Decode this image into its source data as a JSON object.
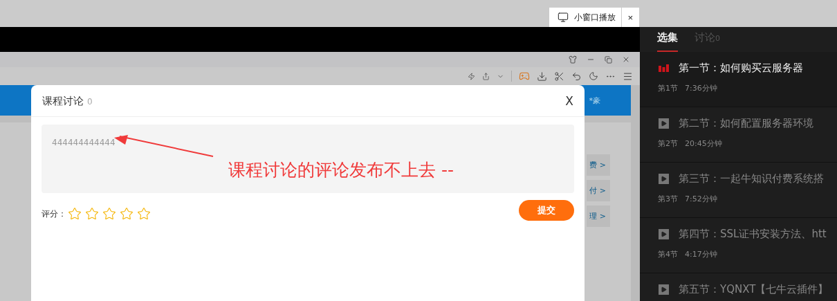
{
  "top_bar": {
    "pip_button": "小窗口播放",
    "close_button": "×"
  },
  "browser": {
    "header_text": "*豪",
    "side_links": [
      "费 >",
      "付 >",
      "理 >"
    ]
  },
  "dialog": {
    "title": "课程讨论",
    "count": "0",
    "close": "X",
    "comment": "444444444444",
    "rating_label": "评分：",
    "stars": 0,
    "submit": "提交"
  },
  "annotation": {
    "text": "课程讨论的评论发布不上去 --"
  },
  "sidebar": {
    "tabs": [
      {
        "label": "选集",
        "selected": true
      },
      {
        "label": "讨论",
        "count": "0",
        "selected": false
      }
    ],
    "episodes": [
      {
        "title": "第一节：如何购买云服务器",
        "number": "第1节",
        "duration": "7:36分钟",
        "playing": true
      },
      {
        "title": "第二节：如何配置服务器环境",
        "number": "第2节",
        "duration": "20:45分钟",
        "playing": false
      },
      {
        "title": "第三节：一起牛知识付费系统搭",
        "number": "第3节",
        "duration": "7:52分钟",
        "playing": false
      },
      {
        "title": "第四节：SSL证书安装方法、htt",
        "number": "第4节",
        "duration": "4:17分钟",
        "playing": false
      },
      {
        "title": "第五节：YQNXT【七牛云插件】",
        "playing": false
      }
    ]
  }
}
